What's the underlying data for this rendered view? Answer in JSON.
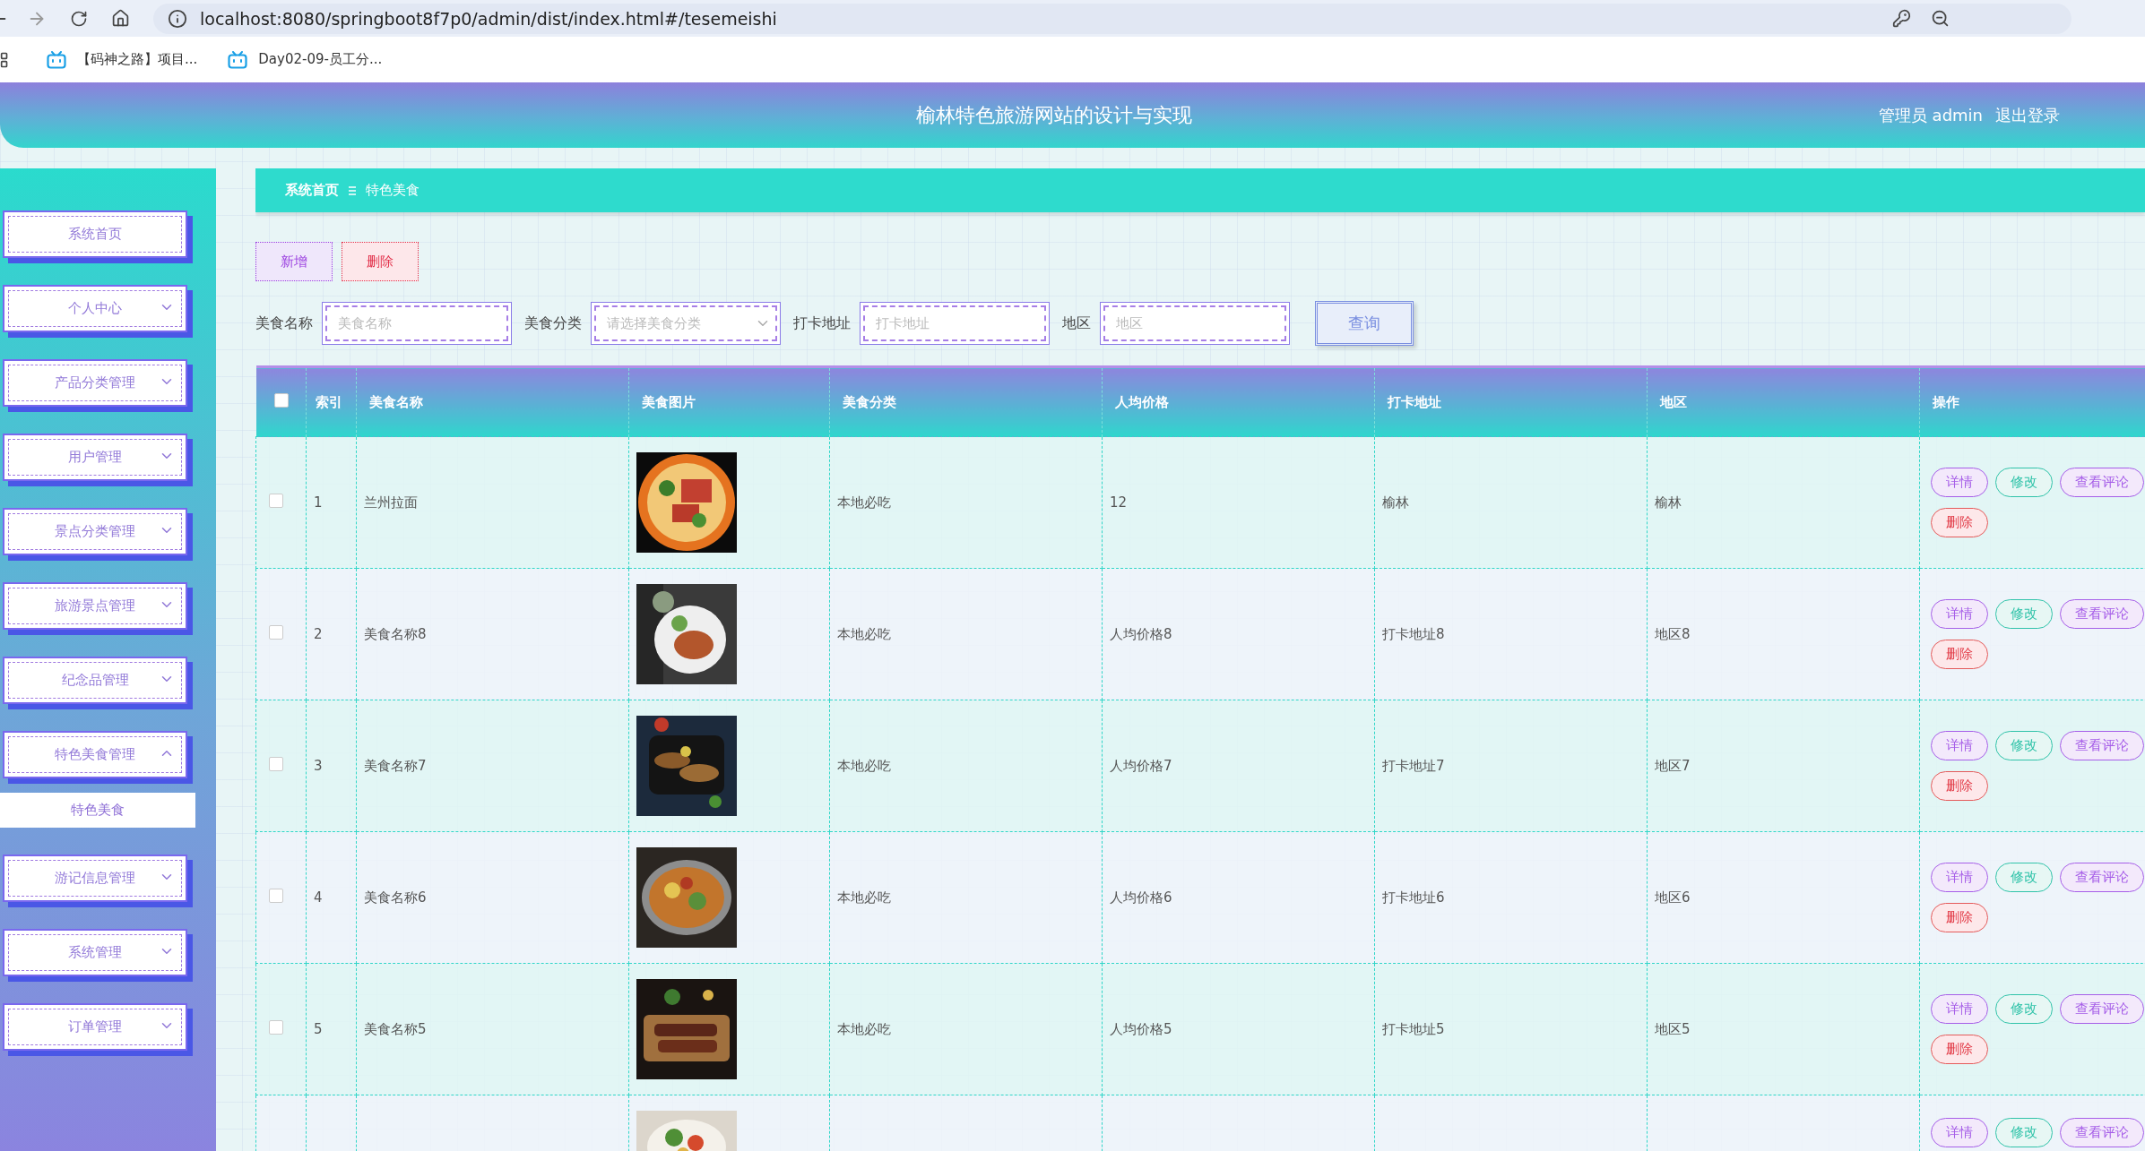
{
  "browser": {
    "url": "localhost:8080/springboot8f7p0/admin/dist/index.html#/tesemeishi",
    "bookmarks": [
      "【码神之路】项目...",
      "Day02-09-员工分..."
    ]
  },
  "header": {
    "title": "榆林特色旅游网站的设计与实现",
    "user": "管理员 admin",
    "logout": "退出登录"
  },
  "sidebar": {
    "items": [
      {
        "label": "系统首页",
        "kind": "link"
      },
      {
        "label": "个人中心",
        "kind": "group",
        "expanded": false
      },
      {
        "label": "产品分类管理",
        "kind": "group",
        "expanded": false
      },
      {
        "label": "用户管理",
        "kind": "group",
        "expanded": false
      },
      {
        "label": "景点分类管理",
        "kind": "group",
        "expanded": false
      },
      {
        "label": "旅游景点管理",
        "kind": "group",
        "expanded": false
      },
      {
        "label": "纪念品管理",
        "kind": "group",
        "expanded": false
      },
      {
        "label": "特色美食管理",
        "kind": "group",
        "expanded": true,
        "children": [
          {
            "label": "特色美食",
            "selected": true
          }
        ]
      },
      {
        "label": "游记信息管理",
        "kind": "group",
        "expanded": false
      },
      {
        "label": "系统管理",
        "kind": "group",
        "expanded": false
      },
      {
        "label": "订单管理",
        "kind": "group",
        "expanded": false
      }
    ]
  },
  "breadcrumb": [
    "系统首页",
    "特色美食"
  ],
  "toolbar": [
    {
      "label": "新增",
      "kind": "add"
    },
    {
      "label": "删除",
      "kind": "delete"
    }
  ],
  "search": {
    "fields": [
      {
        "label": "美食名称",
        "placeholder": "美食名称",
        "kind": "text"
      },
      {
        "label": "美食分类",
        "placeholder": "请选择美食分类",
        "kind": "select"
      },
      {
        "label": "打卡地址",
        "placeholder": "打卡地址",
        "kind": "text"
      },
      {
        "label": "地区",
        "placeholder": "地区",
        "kind": "text"
      }
    ],
    "button": "查询"
  },
  "table": {
    "select_all": {
      "checked": false
    },
    "columns": [
      "索引",
      "美食名称",
      "美食图片",
      "美食分类",
      "人均价格",
      "打卡地址",
      "地区",
      "操作"
    ],
    "rows": [
      {
        "checked": false,
        "index": "1",
        "name": "兰州拉面",
        "category": "本地必吃",
        "price": "12",
        "address": "榆林",
        "region": "榆林",
        "actions": [
          {
            "label": "详情",
            "kind": "detail"
          },
          {
            "label": "修改",
            "kind": "edit"
          },
          {
            "label": "查看评论",
            "kind": "comments"
          },
          {
            "label": "删除",
            "kind": "delete"
          }
        ]
      },
      {
        "checked": false,
        "index": "2",
        "name": "美食名称8",
        "category": "本地必吃",
        "price": "人均价格8",
        "address": "打卡地址8",
        "region": "地区8",
        "actions": [
          {
            "label": "详情",
            "kind": "detail"
          },
          {
            "label": "修改",
            "kind": "edit"
          },
          {
            "label": "查看评论",
            "kind": "comments"
          },
          {
            "label": "删除",
            "kind": "delete"
          }
        ]
      },
      {
        "checked": false,
        "index": "3",
        "name": "美食名称7",
        "category": "本地必吃",
        "price": "人均价格7",
        "address": "打卡地址7",
        "region": "地区7",
        "actions": [
          {
            "label": "详情",
            "kind": "detail"
          },
          {
            "label": "修改",
            "kind": "edit"
          },
          {
            "label": "查看评论",
            "kind": "comments"
          },
          {
            "label": "删除",
            "kind": "delete"
          }
        ]
      },
      {
        "checked": false,
        "index": "4",
        "name": "美食名称6",
        "category": "本地必吃",
        "price": "人均价格6",
        "address": "打卡地址6",
        "region": "地区6",
        "actions": [
          {
            "label": "详情",
            "kind": "detail"
          },
          {
            "label": "修改",
            "kind": "edit"
          },
          {
            "label": "查看评论",
            "kind": "comments"
          },
          {
            "label": "删除",
            "kind": "delete"
          }
        ]
      },
      {
        "checked": false,
        "index": "5",
        "name": "美食名称5",
        "category": "本地必吃",
        "price": "人均价格5",
        "address": "打卡地址5",
        "region": "地区5",
        "actions": [
          {
            "label": "详情",
            "kind": "detail"
          },
          {
            "label": "修改",
            "kind": "edit"
          },
          {
            "label": "查看评论",
            "kind": "comments"
          },
          {
            "label": "删除",
            "kind": "delete"
          }
        ]
      },
      {
        "actions": [
          {
            "label": "详情",
            "kind": "detail"
          },
          {
            "label": "修改",
            "kind": "edit"
          },
          {
            "label": "查看评论",
            "kind": "comments"
          }
        ]
      }
    ]
  }
}
